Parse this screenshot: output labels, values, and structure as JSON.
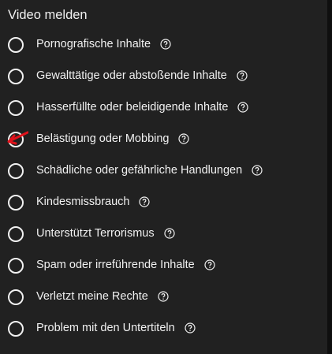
{
  "dialog": {
    "title": "Video melden"
  },
  "options": [
    {
      "label": "Pornografische Inhalte"
    },
    {
      "label": "Gewalttätige oder abstoßende Inhalte"
    },
    {
      "label": "Hasserfüllte oder beleidigende Inhalte"
    },
    {
      "label": "Belästigung oder Mobbing"
    },
    {
      "label": "Schädliche oder gefährliche Handlungen"
    },
    {
      "label": "Kindesmissbrauch"
    },
    {
      "label": "Unterstützt Terrorismus"
    },
    {
      "label": "Spam oder irreführende Inhalte"
    },
    {
      "label": "Verletzt meine Rechte"
    },
    {
      "label": "Problem mit den Untertiteln"
    }
  ],
  "icons": {
    "help": "help-circle-icon",
    "annotation": "red-arrow-icon"
  },
  "colors": {
    "background": "#212121",
    "text": "#f1f1f1",
    "annotation": "#e0121b"
  }
}
